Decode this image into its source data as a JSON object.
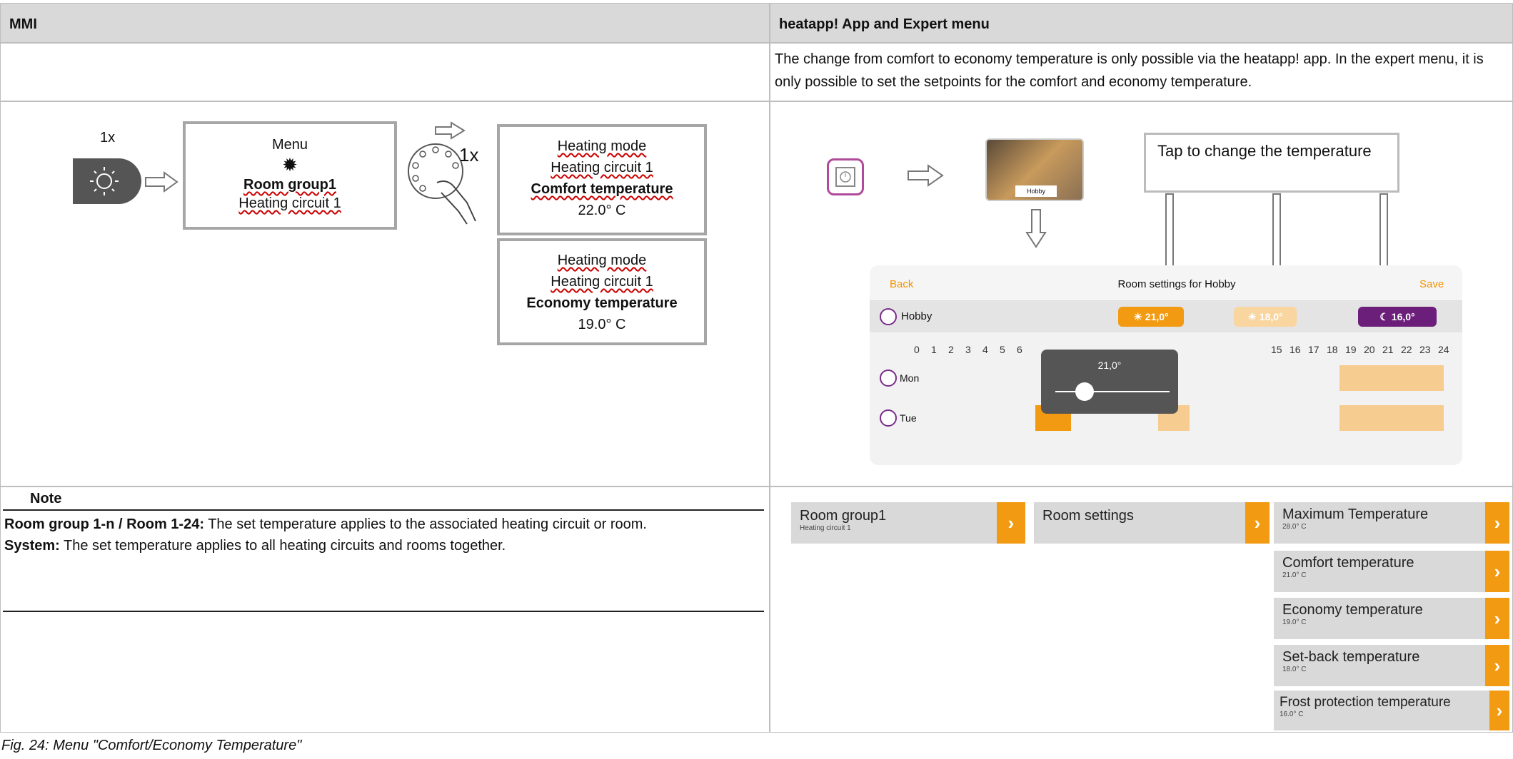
{
  "table": {
    "col_left_header": "MMI",
    "col_right_header": "heatapp!  App and Expert menu",
    "intro_text": "The change from comfort to economy temperature is only possible via the heatapp! app. In the expert menu, it is only possible to set the setpoints for the comfort and economy temperature."
  },
  "mmi": {
    "press_count": "1x",
    "rotate_count": "1x",
    "menu_box": {
      "line1": "Menu",
      "line2": "Room group1",
      "line3": "Heating circuit 1"
    },
    "comfort_box": {
      "line1": "Heating mode",
      "line2": "Heating circuit 1",
      "line3": "Comfort temperature",
      "line4": "22.0° C"
    },
    "economy_box": {
      "line1": "Heating mode",
      "line2": "Heating circuit 1",
      "line3": "Economy temperature",
      "line4": "19.0° C"
    }
  },
  "app": {
    "tile_label": "Hobby",
    "callout": "Tap to change the temperature",
    "back": "Back",
    "title": "Room settings for Hobby",
    "save": "Save",
    "room": "Hobby",
    "comfort_pill": "21,0°",
    "setback_pill": "18,0°",
    "eco_pill": "16,0°",
    "slider_value": "21,0°",
    "hours": [
      "0",
      "1",
      "2",
      "3",
      "4",
      "5",
      "6",
      "15",
      "16",
      "17",
      "18",
      "19",
      "20",
      "21",
      "22",
      "23",
      "24"
    ],
    "day1": "Mon",
    "day2": "Tue"
  },
  "note": {
    "title": "Note",
    "line1_bold": "Room group 1-n / Room 1-24:",
    "line1_rest": " The set temperature applies to the associated heating circuit or room.",
    "line2_bold": "System:",
    "line2_rest": " The set temperature applies to all heating circuits and rooms together."
  },
  "expert_menu": {
    "room_group": {
      "label": "Room group1",
      "sub": "Heating circuit 1"
    },
    "room_settings": {
      "label": "Room settings"
    },
    "items": [
      {
        "label": "Maximum Temperature",
        "sub": "28.0° C"
      },
      {
        "label": "Comfort temperature",
        "sub": "21.0° C"
      },
      {
        "label": "Economy temperature",
        "sub": "19.0° C"
      },
      {
        "label": "Set-back temperature",
        "sub": "18.0° C"
      },
      {
        "label": "Frost protection temperature",
        "sub": "16.0° C"
      }
    ]
  },
  "caption": "Fig. 24: Menu \"Comfort/Economy Temperature\"",
  "colors": {
    "accent_orange": "#f29a12",
    "header_gray": "#d9d9d9",
    "purple": "#6b1f7a"
  }
}
